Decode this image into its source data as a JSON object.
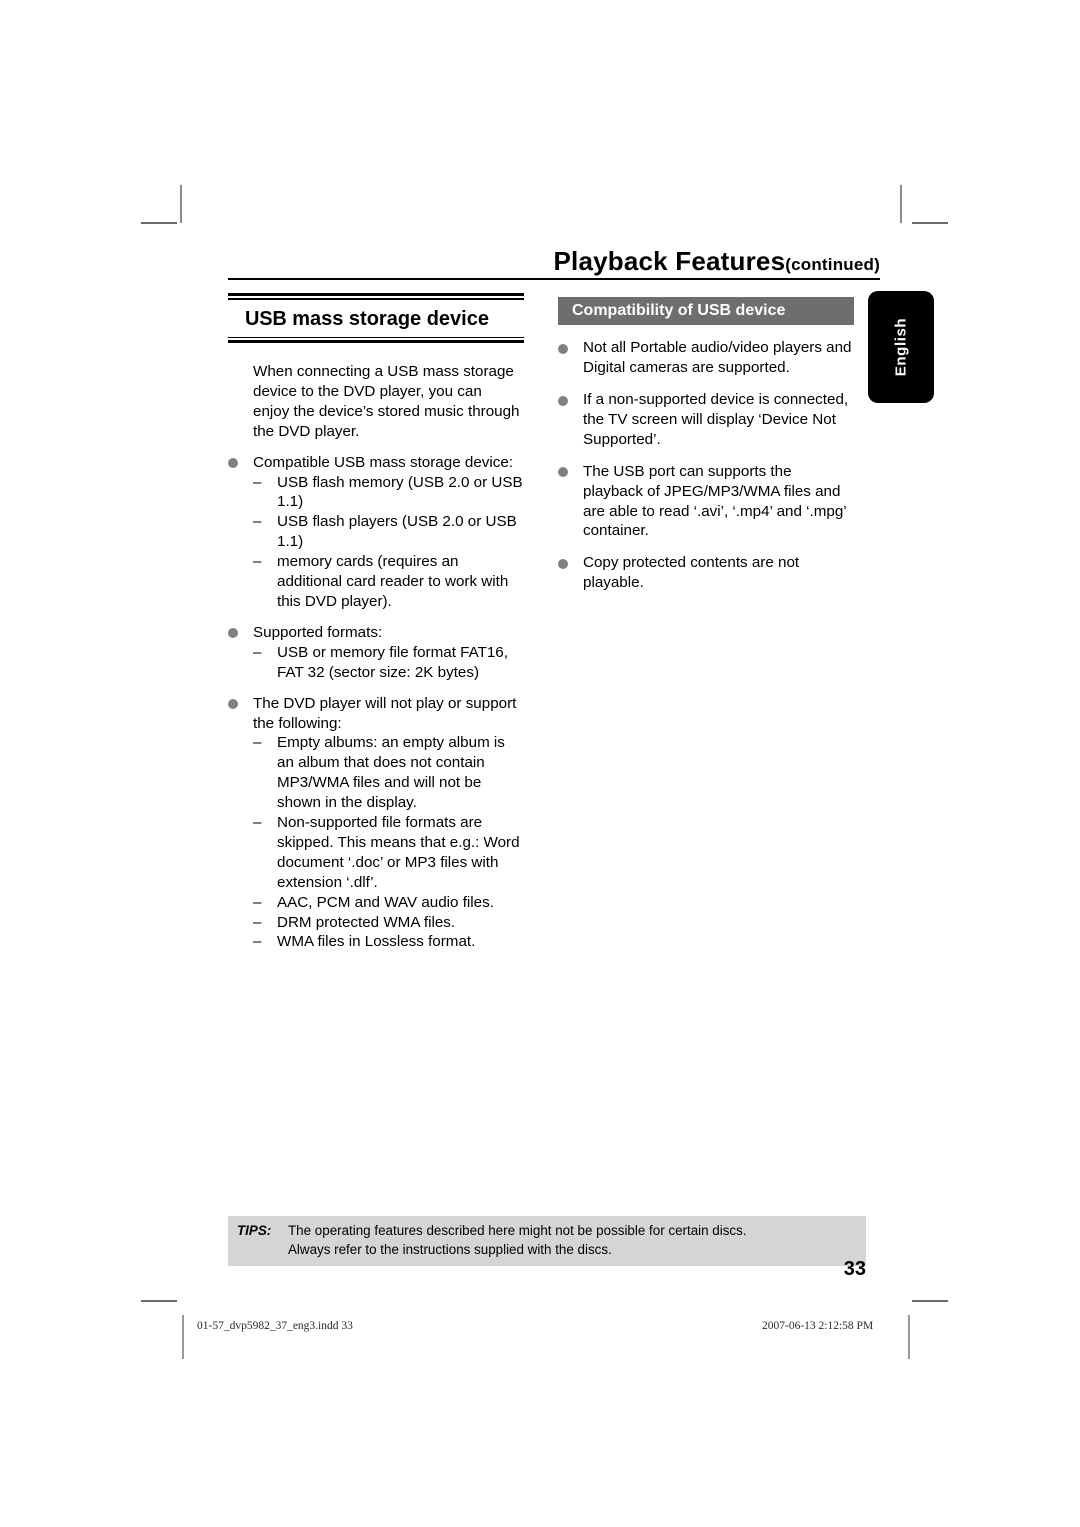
{
  "header": {
    "title_main": "Playback Features",
    "title_suffix": "(continued)"
  },
  "left_column": {
    "section_heading_lead": "USB",
    "section_heading_rest": " mass storage device",
    "intro": "When connecting a USB mass storage device to the DVD player, you can enjoy the device’s stored music through the DVD player.",
    "bullets": [
      {
        "text": "Compatible USB mass storage device:",
        "sub": [
          "USB flash memory (USB 2.0 or USB 1.1)",
          "USB flash players (USB 2.0 or USB 1.1)",
          "memory cards (requires an additional card reader to work with this DVD player)."
        ]
      },
      {
        "text": "Supported formats:",
        "sub": [
          "USB or memory file format FAT16, FAT 32 (sector size: 2K bytes)"
        ]
      },
      {
        "text": "The DVD player will not play or support the following:",
        "sub": [
          "Empty albums: an empty album is an album that does not contain MP3/WMA files and will not be shown in the display.",
          "Non-supported file formats are skipped. This means that e.g.: Word document ‘.doc’ or MP3 files with extension ‘.dlf’.",
          "AAC, PCM and WAV audio files.",
          "DRM protected WMA files.",
          "WMA files in Lossless format."
        ]
      }
    ],
    "dash_glyph": "–"
  },
  "right_column": {
    "band_title": "Compatibility of USB device",
    "bullets": [
      "Not all Portable audio/video players and Digital cameras are supported.",
      "If a non-supported device is connected, the TV screen will display ‘Device Not Supported’.",
      "The USB port can supports the playback of JPEG/MP3/WMA files and are able to read ‘.avi’, ‘.mp4’ and ‘.mpg’ container.",
      "Copy protected contents are not playable."
    ]
  },
  "language_tab": {
    "label": "English"
  },
  "tips": {
    "label": "TIPS:",
    "line1": "The operating features described here might not be possible for certain discs.",
    "line2": "Always refer to the instructions supplied with the discs."
  },
  "page_number": "33",
  "imposition_footer": {
    "file": "01-57_dvp5982_37_eng3.indd   33",
    "timestamp": "2007-06-13   2:12:58 PM"
  },
  "colors": {
    "band_gray": "#6e6e6e",
    "tips_gray": "#d5d5d5",
    "bullet_gray": "#808080",
    "tab_black": "#000000",
    "crop_mark": "#8a8a8a"
  }
}
